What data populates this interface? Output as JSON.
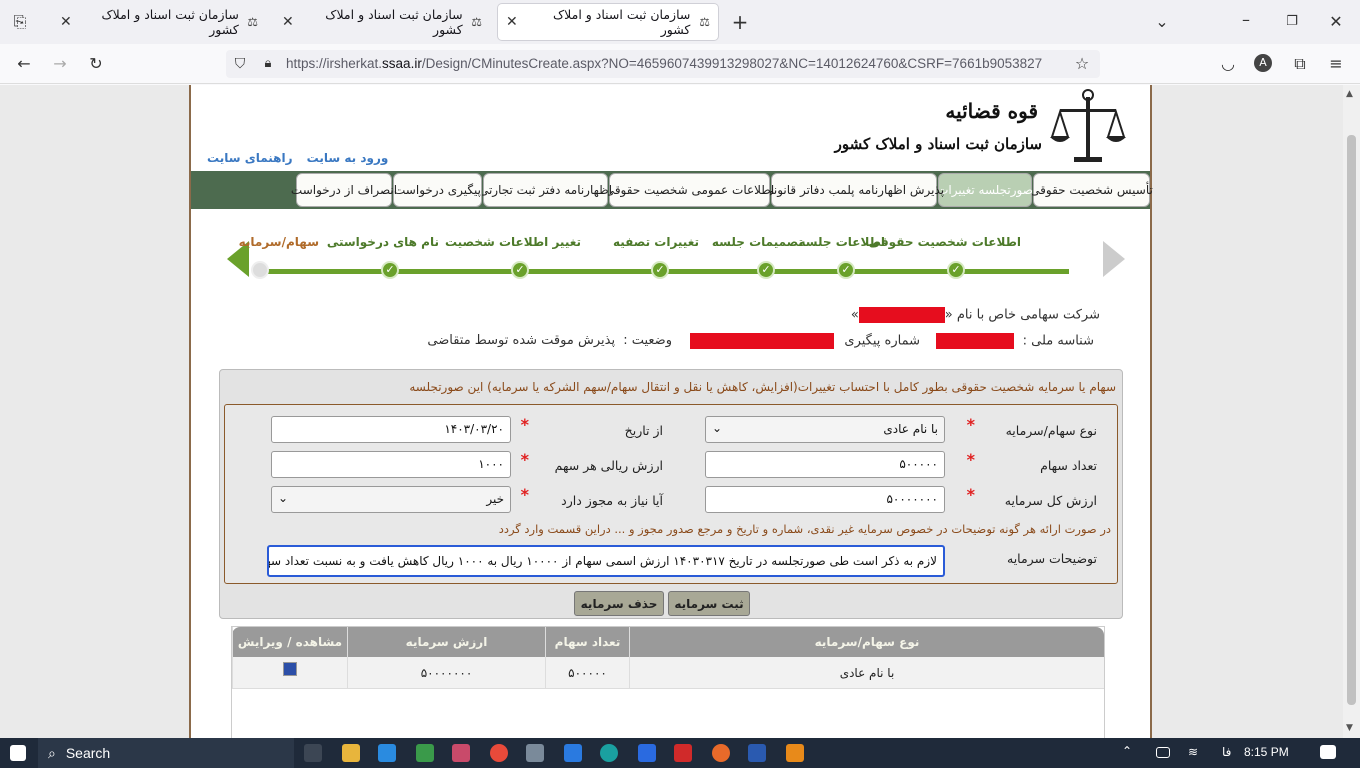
{
  "browser": {
    "tabs": [
      {
        "title": "سازمان ثبت اسناد و املاک کشور",
        "active": false
      },
      {
        "title": "سازمان ثبت اسناد و املاک کشور",
        "active": false
      },
      {
        "title": "سازمان ثبت اسناد و املاک کشور",
        "active": true
      }
    ],
    "url_host": "https://irsherkat.",
    "url_domain": "ssaa.ir",
    "url_path": "/Design/CMinutesCreate.aspx?NO=465960743991329802­7&NC=14012624760&CSRF=7661b9053827",
    "icons": [
      "tab-list-icon",
      "back-icon",
      "forward-icon",
      "reload-icon",
      "shield-icon",
      "lock-icon",
      "bookmark-star-icon",
      "pocket-icon",
      "account-icon",
      "extensions-icon",
      "menu-icon"
    ]
  },
  "header": {
    "org_line1": "قوه قضائیه",
    "org_line2": "سازمان ثبت اسناد و املاک کشور",
    "login_link": "ورود به سایت",
    "guide_link": "راهنمای سایت"
  },
  "nav": {
    "items": [
      "تأسیس شخصیت حقوقی",
      "صورتجلسه تغییرات",
      "پذیرش اظهارنامه پلمب دفاتر قانونی",
      "اطلاعات عمومی شخصیت حقوقی",
      "اظهارنامه دفتر ثبت تجارتی",
      "پیگیری درخواست",
      "انصراف از درخواست"
    ]
  },
  "wizard": {
    "steps": [
      "اطلاعات شخصیت حقوقی",
      "اطلاعات جلسه",
      "تصمیمات جلسه",
      "تغییرات تصفیه",
      "تغییر اطلاعات شخصیت",
      "نام های درخواستی",
      "سهام/سرمایه"
    ]
  },
  "company": {
    "name_prefix": "شرکت سهامی خاص با نام «",
    "name_suffix": "»",
    "national_id_label": "شناسه ملی :",
    "tracking_label": "شماره پیگیری",
    "status_label": "وضعیت :",
    "status_value": "پذیرش موقت شده توسط متقاضی"
  },
  "capital": {
    "title": "سهام یا سرمایه شخصیت حقوقی بطور کامل با احتساب تغییرات(افزایش، کاهش یا نقل و انتقال سهام/سهم الشرکه یا سرمایه) این صورتجلسه",
    "share_type_label": "نوع سهام/سرمایه",
    "share_type_value": "با نام عادی",
    "from_date_label": "از تاریخ",
    "from_date_value": "۱۴۰۳/۰۳/۲۰",
    "share_count_label": "تعداد سهام",
    "share_count_value": "۵۰۰۰۰۰",
    "share_value_label": "ارزش ریالی هر سهم",
    "share_value_value": "۱۰۰۰",
    "total_label": "ارزش کل سرمایه",
    "total_value": "۵۰۰۰۰۰۰۰",
    "permit_label": "آیا نیاز به مجوز دارد",
    "permit_value": "خیر",
    "hint": "در صورت ارائه هر گونه توضیحات در خصوص سرمایه غیر نقدی، شماره و تاریخ و مرجع صدور مجوز و ... دراین قسمت وارد گردد",
    "desc_label": "توضیحات سرمایه",
    "desc_value": "لازم به ذکر است طی صورتجلسه در تاریخ ۱۴۰۳۰۳۱۷ ارزش اسمی سهام از ۱۰۰۰۰ ریال به ۱۰۰۰ ریال کاهش یافت و به نسبت تعداد سهام در آن تاریخ",
    "save_button": "ثبت سرمایه",
    "delete_button": "حذف سرمایه"
  },
  "grid": {
    "headers": [
      "نوع سهام/سرمایه",
      "تعداد سهام",
      "ارزش سرمایه",
      "مشاهده / ویرایش"
    ],
    "rows": [
      {
        "type": "با نام عادی",
        "count": "۵۰۰۰۰۰",
        "value": "۵۰۰۰۰۰۰۰"
      }
    ]
  },
  "taskbar": {
    "search_label": "Search",
    "lang": "فا",
    "time": "8:15 PM"
  }
}
